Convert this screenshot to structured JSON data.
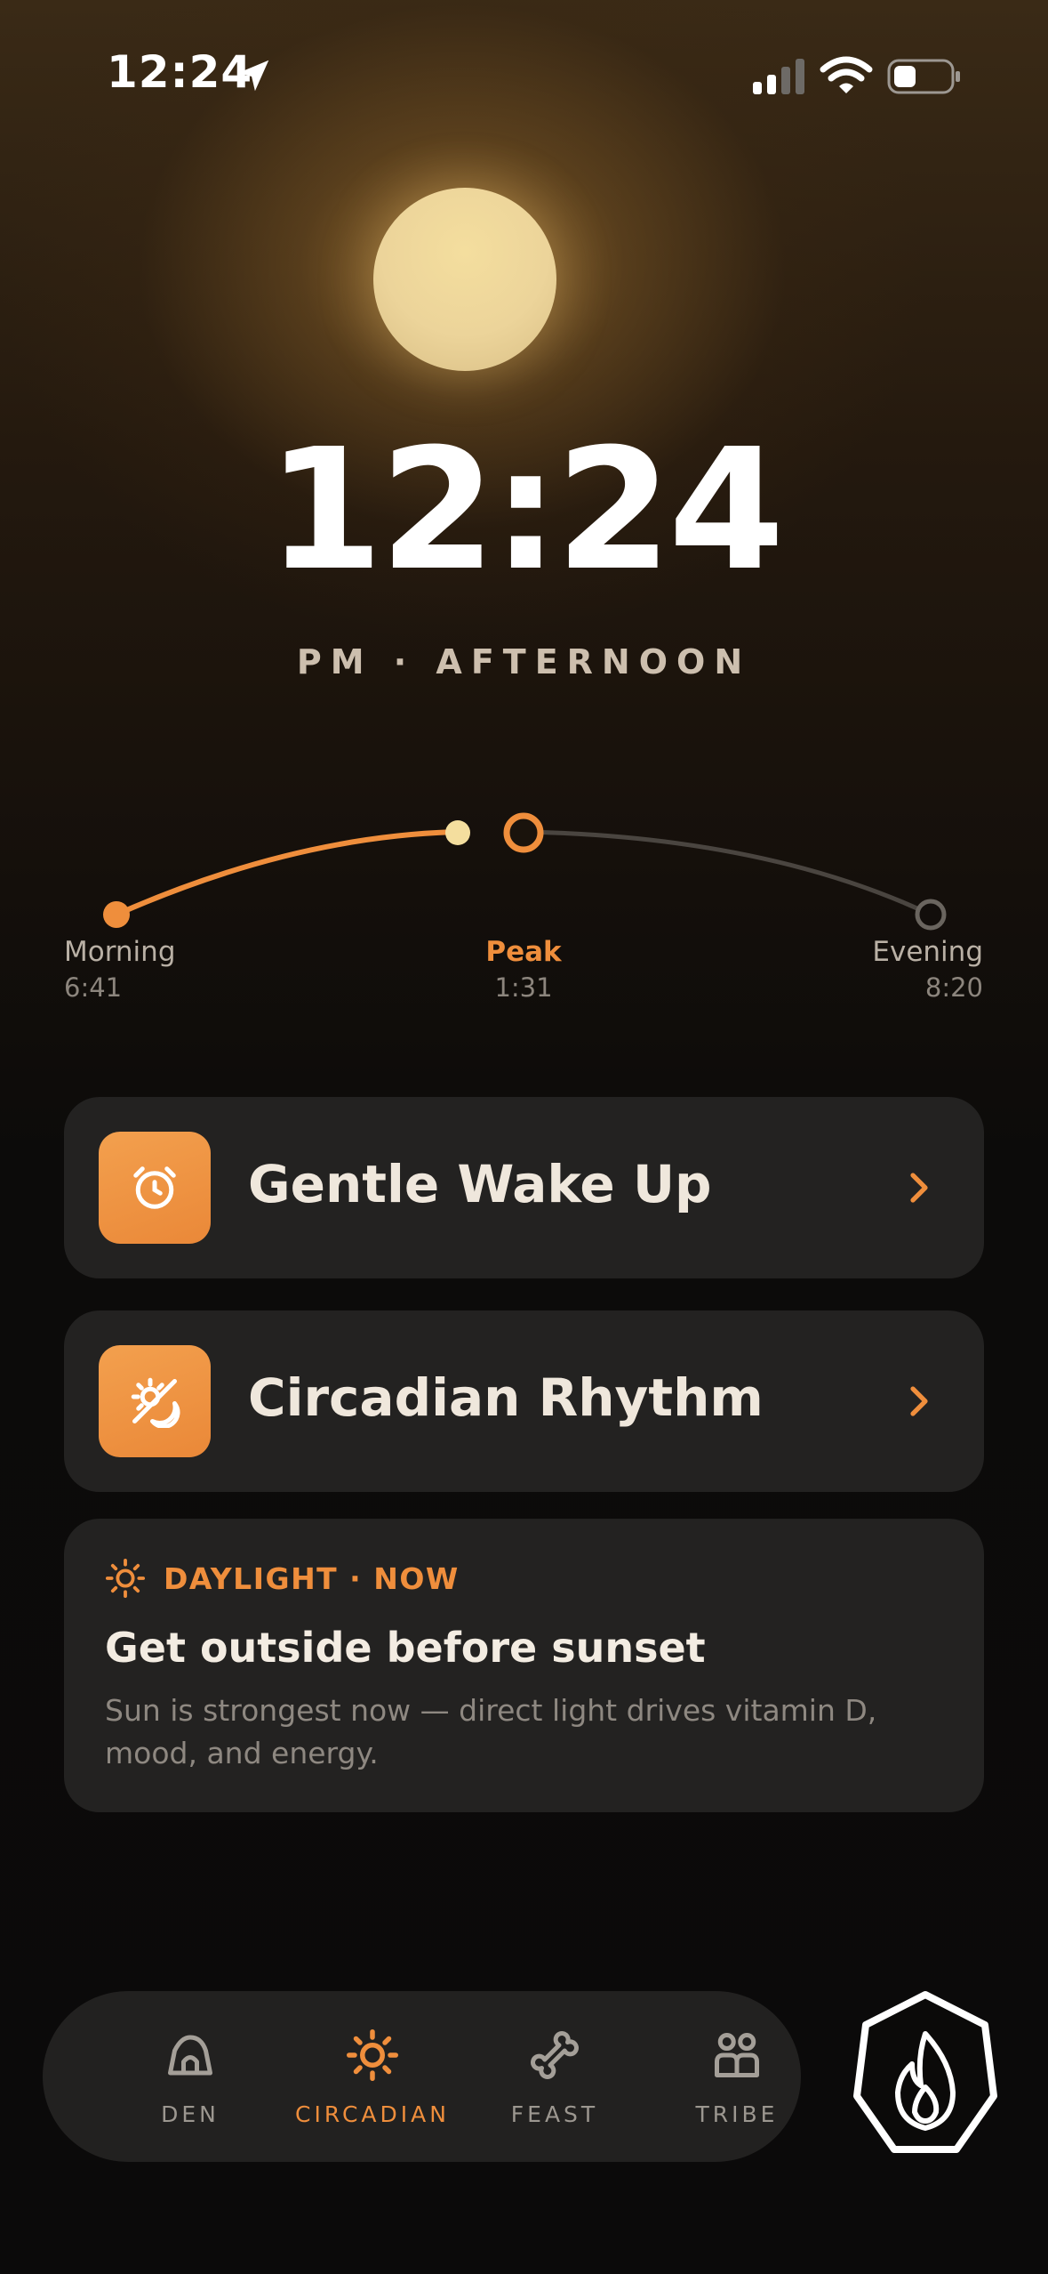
{
  "status_bar": {
    "time": "12:24",
    "icons": [
      "location-arrow-icon",
      "cellular-signal-icon",
      "wifi-icon",
      "battery-icon"
    ]
  },
  "hero": {
    "time": "12:24",
    "period": "PM · AFTERNOON"
  },
  "sun_arc": {
    "morning": {
      "label": "Morning",
      "time": "6:41"
    },
    "peak": {
      "label": "Peak",
      "time": "1:31"
    },
    "evening": {
      "label": "Evening",
      "time": "8:20"
    }
  },
  "cards": [
    {
      "title": "Gentle Wake Up",
      "icon": "alarm-clock-icon"
    },
    {
      "title": "Circadian Rhythm",
      "icon": "sun-moon-icon"
    }
  ],
  "info_card": {
    "eyebrow": "DAYLIGHT · NOW",
    "title": "Get outside before sunset",
    "body": "Sun is strongest now — direct light drives vitamin D, mood, and energy."
  },
  "tabs": [
    {
      "label": "DEN",
      "icon": "cave-icon",
      "active": false
    },
    {
      "label": "CIRCADIAN",
      "icon": "sun-icon",
      "active": true
    },
    {
      "label": "FEAST",
      "icon": "bone-icon",
      "active": false
    },
    {
      "label": "TRIBE",
      "icon": "people-icon",
      "active": false
    }
  ],
  "fab": {
    "icon": "flame-icon"
  },
  "colors": {
    "accent": "#ef8e3c",
    "card_bg": "#232221",
    "sun": "#ecd49a"
  }
}
